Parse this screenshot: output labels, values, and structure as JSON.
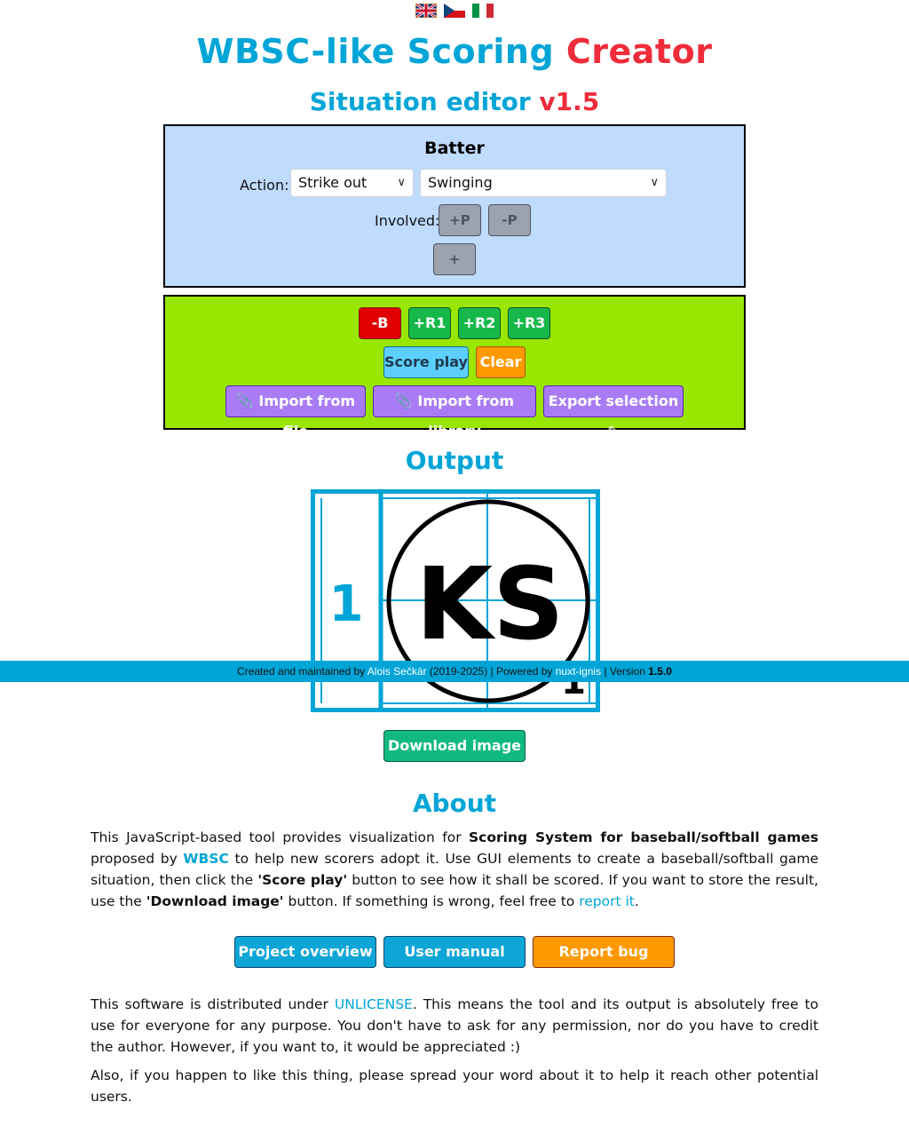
{
  "flags": [
    {
      "name": "english-flag-icon",
      "lang": "en"
    },
    {
      "name": "czech-flag-icon",
      "lang": "cs"
    },
    {
      "name": "italian-flag-icon",
      "lang": "it"
    }
  ],
  "header": {
    "title_main": "WBSC-like Scoring",
    "title_accent": "Creator",
    "subtitle_main": "Situation editor",
    "subtitle_version": "v1.5"
  },
  "batter": {
    "title": "Batter",
    "action_label": "Action:",
    "action_value": "Strike out",
    "specific_value": "Swinging",
    "involved_label": "Involved:",
    "add_player": "+P",
    "remove_player": "-P",
    "add_action": "+"
  },
  "controls": {
    "remove_batter": "-B",
    "add_r1": "+R1",
    "add_r2": "+R2",
    "add_r3": "+R3",
    "score_play": "Score play",
    "clear": "Clear",
    "import_file": "Import from file",
    "import_library": "Import from library",
    "export_selection": "Export selection"
  },
  "output": {
    "heading": "Output",
    "left_number": "1",
    "center_text": "KS",
    "corner_number": "1",
    "download": "Download image"
  },
  "footer": {
    "prefix": "Created and maintained by",
    "author": "Alois Sečkár",
    "years": "(2019-2025) | Powered by",
    "engine": "nuxt-ignis",
    "version_label": "| Version",
    "version": "1.5.0"
  },
  "about": {
    "heading": "About",
    "p1_a": "This JavaScript-based tool provides visualization for",
    "p1_b": "Scoring System for baseball/softball games",
    "p1_c": "proposed by",
    "p1_wbsc": "WBSC",
    "p1_d": "to help new scorers adopt it. Use GUI elements to create a baseball/softball game situation, then click the",
    "p1_e": "'Score play'",
    "p1_f": "button to see how it shall be scored. If you want to store the result, use the",
    "p1_g": "'Download image'",
    "p1_h": "button. If something is wrong, feel free to",
    "p1_link": "report it",
    "p1_end": ".",
    "btn_overview": "Project overview",
    "btn_manual": "User manual",
    "btn_bug": "Report bug",
    "p2_a": "This software is distributed under",
    "p2_link": "UNLICENSE",
    "p2_b": ". This means the tool and its output is absolutely free to use for everyone for any purpose. You don't have to ask for any permission, nor do you have to credit the author. However, if you want to, it would be appreciated :)",
    "p3": "Also, if you happen to like this thing, please spread your word about it to help it reach other potential users."
  },
  "colors": {
    "accent": "#00a5d7",
    "accent_red": "#ef2c3a",
    "batter_panel": "#bfdbfe",
    "actions_panel": "#99e600"
  }
}
